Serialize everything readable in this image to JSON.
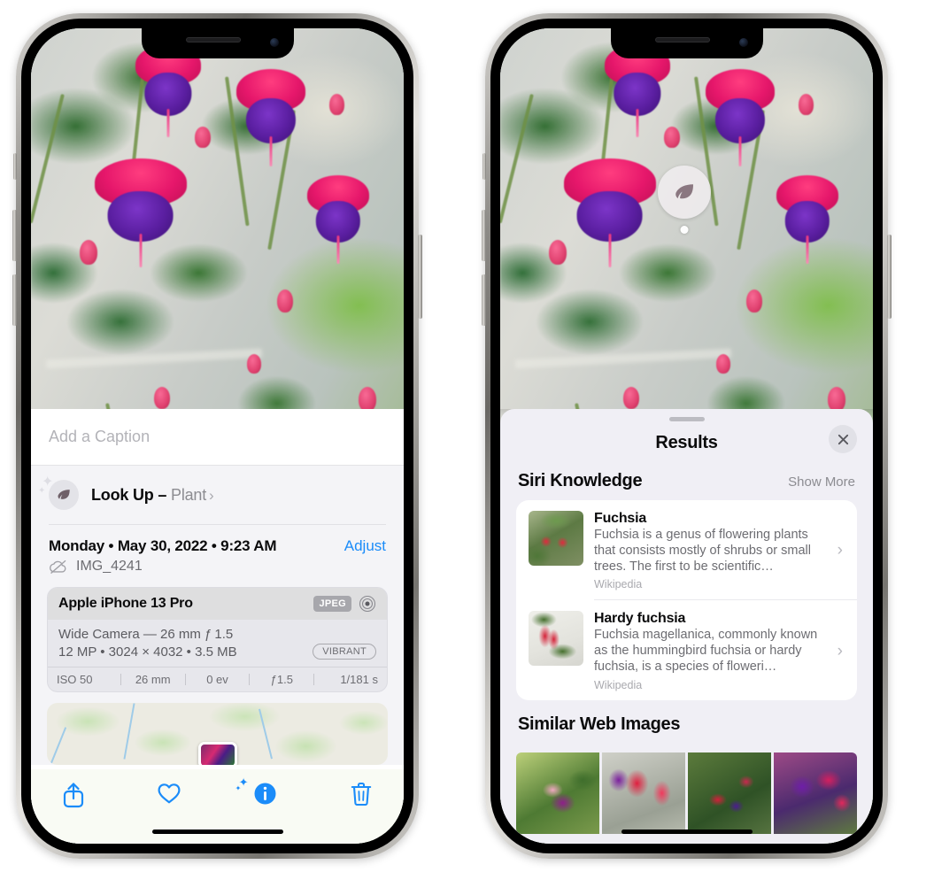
{
  "left_phone": {
    "photo": {
      "alt": "fuchsia-flowers-photo"
    },
    "caption": {
      "placeholder": "Add a Caption",
      "value": ""
    },
    "lookup": {
      "icon": "leaf-icon",
      "label": "Look Up – ",
      "subject": "Plant",
      "chevron": "›"
    },
    "date_row": {
      "date": "Monday • May 30, 2022 • 9:23 AM",
      "adjust_label": "Adjust"
    },
    "file_row": {
      "icon": "no-cloud-icon",
      "filename": "IMG_4241"
    },
    "exif": {
      "device": "Apple iPhone 13 Pro",
      "format_badge": "JPEG",
      "aperture_icon": "aperture-icon",
      "lens": "Wide Camera — 26 mm ƒ 1.5",
      "size_line": "12 MP • 3024 × 4032 • 3.5 MB",
      "style_badge": "VIBRANT",
      "stats": [
        "ISO 50",
        "26 mm",
        "0 ev",
        "ƒ1.5",
        "1/181 s"
      ]
    },
    "map": {
      "alt": "photo-location-map"
    },
    "toolbar": [
      {
        "name": "share-icon",
        "label": "Share"
      },
      {
        "name": "heart-icon",
        "label": "Favorite"
      },
      {
        "name": "info-icon",
        "label": "Info"
      },
      {
        "name": "trash-icon",
        "label": "Delete"
      }
    ]
  },
  "right_phone": {
    "photo": {
      "alt": "fuchsia-flowers-photo"
    },
    "visual_lookup_badge": {
      "icon": "leaf-icon"
    },
    "sheet": {
      "title": "Results",
      "close_icon": "close-icon",
      "siri_knowledge": {
        "title": "Siri Knowledge",
        "show_more": "Show More",
        "items": [
          {
            "title": "Fuchsia",
            "description": "Fuchsia is a genus of flowering plants that consists mostly of shrubs or small trees. The first to be scientific…",
            "source": "Wikipedia",
            "thumb": "fuchsia-red-flowers-thumb",
            "chevron": "›"
          },
          {
            "title": "Hardy fuchsia",
            "description": "Fuchsia magellanica, commonly known as the hummingbird fuchsia or hardy fuchsia, is a species of floweri…",
            "source": "Wikipedia",
            "thumb": "hardy-fuchsia-branch-thumb",
            "chevron": "›"
          }
        ]
      },
      "similar_web_images": {
        "title": "Similar Web Images",
        "items": [
          {
            "alt": "web-image-1-pink-purple-fuchsia"
          },
          {
            "alt": "web-image-2-red-fuchsia-closeup"
          },
          {
            "alt": "web-image-3-fuchsia-bush"
          },
          {
            "alt": "web-image-4-purple-magenta-fuchsia"
          }
        ]
      }
    }
  },
  "colors": {
    "accent_blue": "#1b8cf9",
    "sheet_bg": "#f0eff5",
    "card_bg": "#ffffff",
    "secondary_text": "#6d6d72",
    "tertiary_text": "#a9a9ae"
  }
}
